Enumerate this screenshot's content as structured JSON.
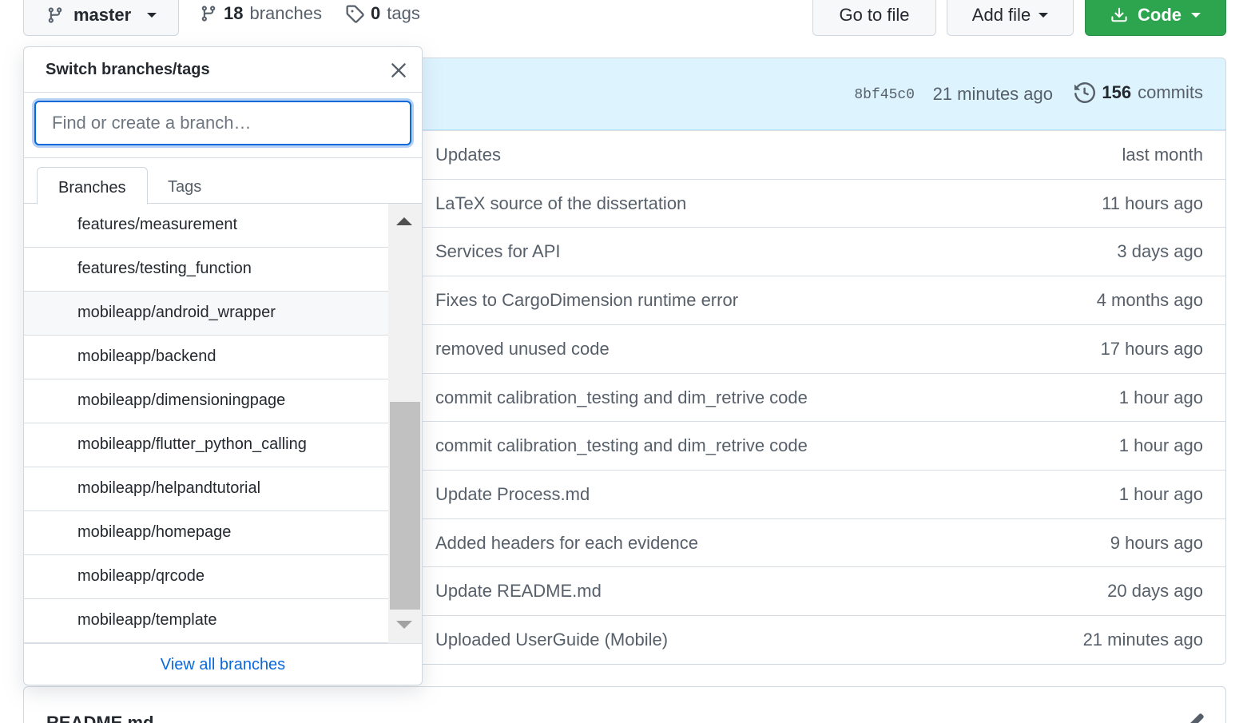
{
  "toolbar": {
    "branch_button_label": "master",
    "branches_count": "18",
    "branches_label": "branches",
    "tags_count": "0",
    "tags_label": "tags",
    "go_to_file_label": "Go to file",
    "add_file_label": "Add file",
    "code_label": "Code",
    "code_button_color": "#2da44e"
  },
  "commit_bar": {
    "hash": "8bf45c0",
    "time": "21 minutes ago",
    "commits_count": "156",
    "commits_label": "commits"
  },
  "files": [
    {
      "message": "Updates",
      "age": "last month"
    },
    {
      "message": "LaTeX source of the dissertation",
      "age": "11 hours ago"
    },
    {
      "message": "Services for API",
      "age": "3 days ago"
    },
    {
      "message": "Fixes to CargoDimension runtime error",
      "age": "4 months ago"
    },
    {
      "message": "removed unused code",
      "age": "17 hours ago"
    },
    {
      "message": "commit calibration_testing and dim_retrive code",
      "age": "1 hour ago"
    },
    {
      "message": "commit calibration_testing and dim_retrive code",
      "age": "1 hour ago"
    },
    {
      "message": "Update Process.md",
      "age": "1 hour ago"
    },
    {
      "message": "Added headers for each evidence",
      "age": "9 hours ago"
    },
    {
      "message": "Update README.md",
      "age": "20 days ago"
    },
    {
      "message": "Uploaded UserGuide (Mobile)",
      "age": "21 minutes ago"
    }
  ],
  "readme": {
    "title": "README.md"
  },
  "dropdown": {
    "title": "Switch branches/tags",
    "filter_placeholder": "Find or create a branch…",
    "filter_value": "",
    "tabs": [
      {
        "label": "Branches",
        "selected": true
      },
      {
        "label": "Tags",
        "selected": false
      }
    ],
    "branches": [
      "features/measurement",
      "features/testing_function",
      "mobileapp/android_wrapper",
      "mobileapp/backend",
      "mobileapp/dimensioningpage",
      "mobileapp/flutter_python_calling",
      "mobileapp/helpandtutorial",
      "mobileapp/homepage",
      "mobileapp/qrcode",
      "mobileapp/template"
    ],
    "hovered_branch_index": 2,
    "view_all_label": "View all branches",
    "accent_color": "#0969da"
  }
}
